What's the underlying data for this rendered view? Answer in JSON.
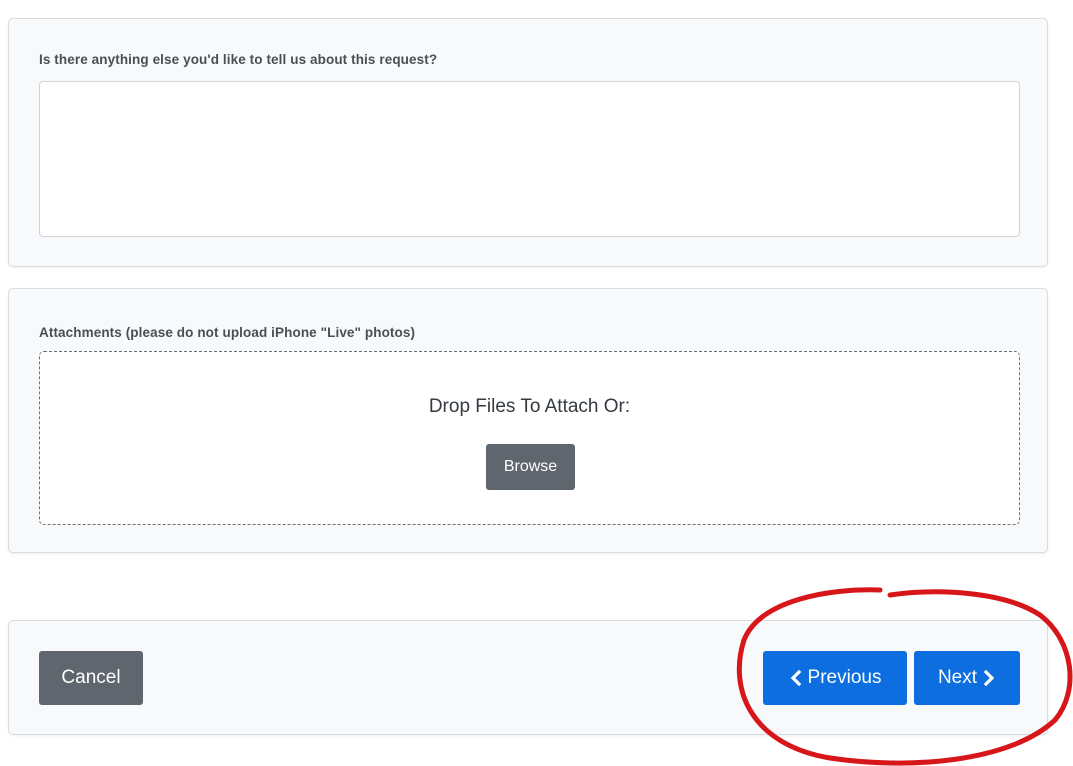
{
  "notes": {
    "label": "Is there anything else you'd like to tell us about this request?",
    "value": "",
    "placeholder": ""
  },
  "attachments": {
    "label": "Attachments (please do not upload iPhone \"Live\" photos)",
    "drop_text": "Drop Files To Attach Or:",
    "browse_label": "Browse"
  },
  "actions": {
    "cancel_label": "Cancel",
    "previous_label": "Previous",
    "next_label": "Next",
    "previous_icon": "chevron-left-icon",
    "next_icon": "chevron-right-icon"
  },
  "colors": {
    "primary": "#0d6ee0",
    "secondary": "#5f666d",
    "card_background": "#f8f9fa",
    "annotation": "#d7161a"
  }
}
